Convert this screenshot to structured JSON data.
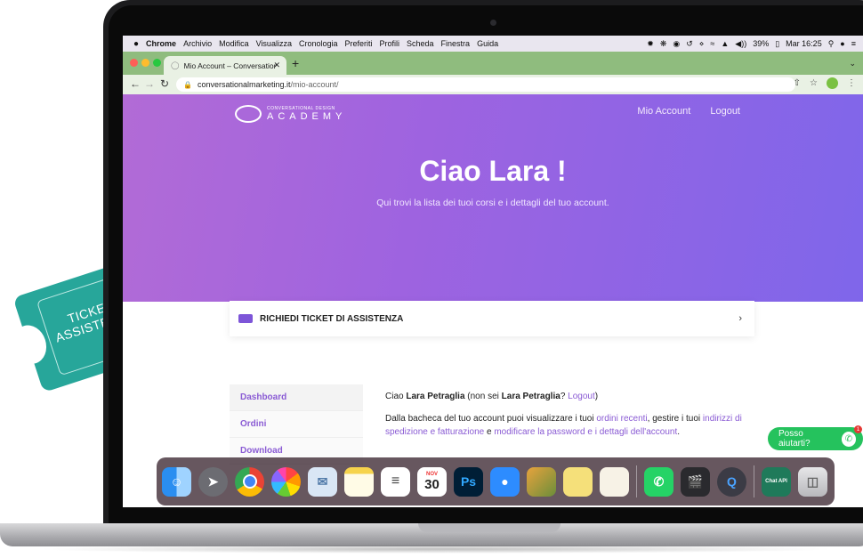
{
  "menubar": {
    "apple": "",
    "items": [
      "Chrome",
      "Archivio",
      "Modifica",
      "Visualizza",
      "Cronologia",
      "Preferiti",
      "Profili",
      "Scheda",
      "Finestra",
      "Guida"
    ],
    "battery": "39%",
    "clock": "Mar 16:25"
  },
  "browser": {
    "tab_title": "Mio Account – Conversational",
    "url_host": "conversationalmarketing.it",
    "url_path": "/mio-account/",
    "tab_color": "#8fbc7e"
  },
  "site": {
    "logo_top": "CONVERSATIONAL DESIGN",
    "logo_bottom": "ACADEMY",
    "nav": [
      "Mio Account",
      "Logout"
    ],
    "hero_title": "Ciao Lara !",
    "hero_subtitle": "Qui trovi la lista dei tuoi corsi e i dettagli del tuo account.",
    "ticket_label": "RICHIEDI TICKET DI ASSISTENZA",
    "sidebar": [
      "Dashboard",
      "Ordini",
      "Download"
    ],
    "content": {
      "greet_prefix": "Ciao ",
      "name": "Lara Petraglia",
      "not_prefix": " (non sei ",
      "not_suffix": "? ",
      "logout": "Logout",
      "close_paren": ")",
      "p2_a": "Dalla bacheca del tuo account puoi visualizzare i tuoi ",
      "link_orders": "ordini recenti",
      "p2_b": ", gestire i tuoi ",
      "link_addresses": "indirizzi di spedizione e fatturazione",
      "p2_c": " e ",
      "link_password": "modificare la password e i dettagli dell'account",
      "p2_d": "."
    },
    "help_button": "Posso aiutarti?",
    "help_badge": "1",
    "accent": "#8a5bd4"
  },
  "dock": {
    "calendar_month": "NOV",
    "calendar_day": "30",
    "ps_label": "Ps",
    "chat_api_label": "Chat API"
  },
  "ticket_decoration": {
    "text": "TICKET ASSISTENZA",
    "color": "#27a69a"
  }
}
